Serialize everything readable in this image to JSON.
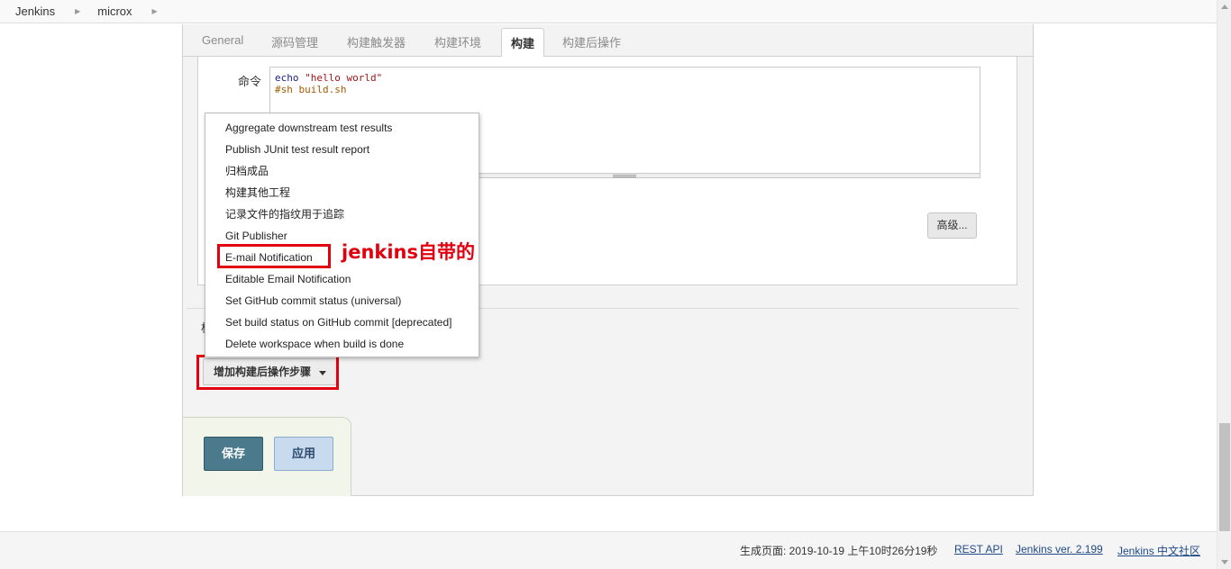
{
  "breadcrumb": {
    "items": [
      "Jenkins",
      "microx"
    ]
  },
  "tabs": [
    "General",
    "源码管理",
    "构建触发器",
    "构建环境",
    "构建",
    "构建后操作"
  ],
  "active_tab": "构建",
  "command": {
    "label": "命令",
    "line1_cmd": "echo ",
    "line1_str": "\"hello world\"",
    "line2": "#sh build.sh"
  },
  "advanced_label": "高级...",
  "truncated_label": "构",
  "dropdown": {
    "items": [
      "Aggregate downstream test results",
      "Publish JUnit test result report",
      "归档成品",
      "构建其他工程",
      "记录文件的指纹用于追踪",
      "Git Publisher",
      "E-mail Notification",
      "Editable Email Notification",
      "Set GitHub commit status (universal)",
      "Set build status on GitHub commit [deprecated]",
      "Delete workspace when build is done"
    ]
  },
  "annotation": "jenkins自带的",
  "add_post_build_label": "增加构建后操作步骤",
  "buttons": {
    "save": "保存",
    "apply": "应用"
  },
  "footer": {
    "generated": "生成页面: 2019-10-19 上午10时26分19秒",
    "rest_api": "REST API",
    "version": "Jenkins ver. 2.199",
    "community": "Jenkins 中文社区"
  },
  "colors": {
    "highlight": "#e2000f",
    "save_bg": "#4a7a8c",
    "apply_bg": "#c8daee"
  }
}
